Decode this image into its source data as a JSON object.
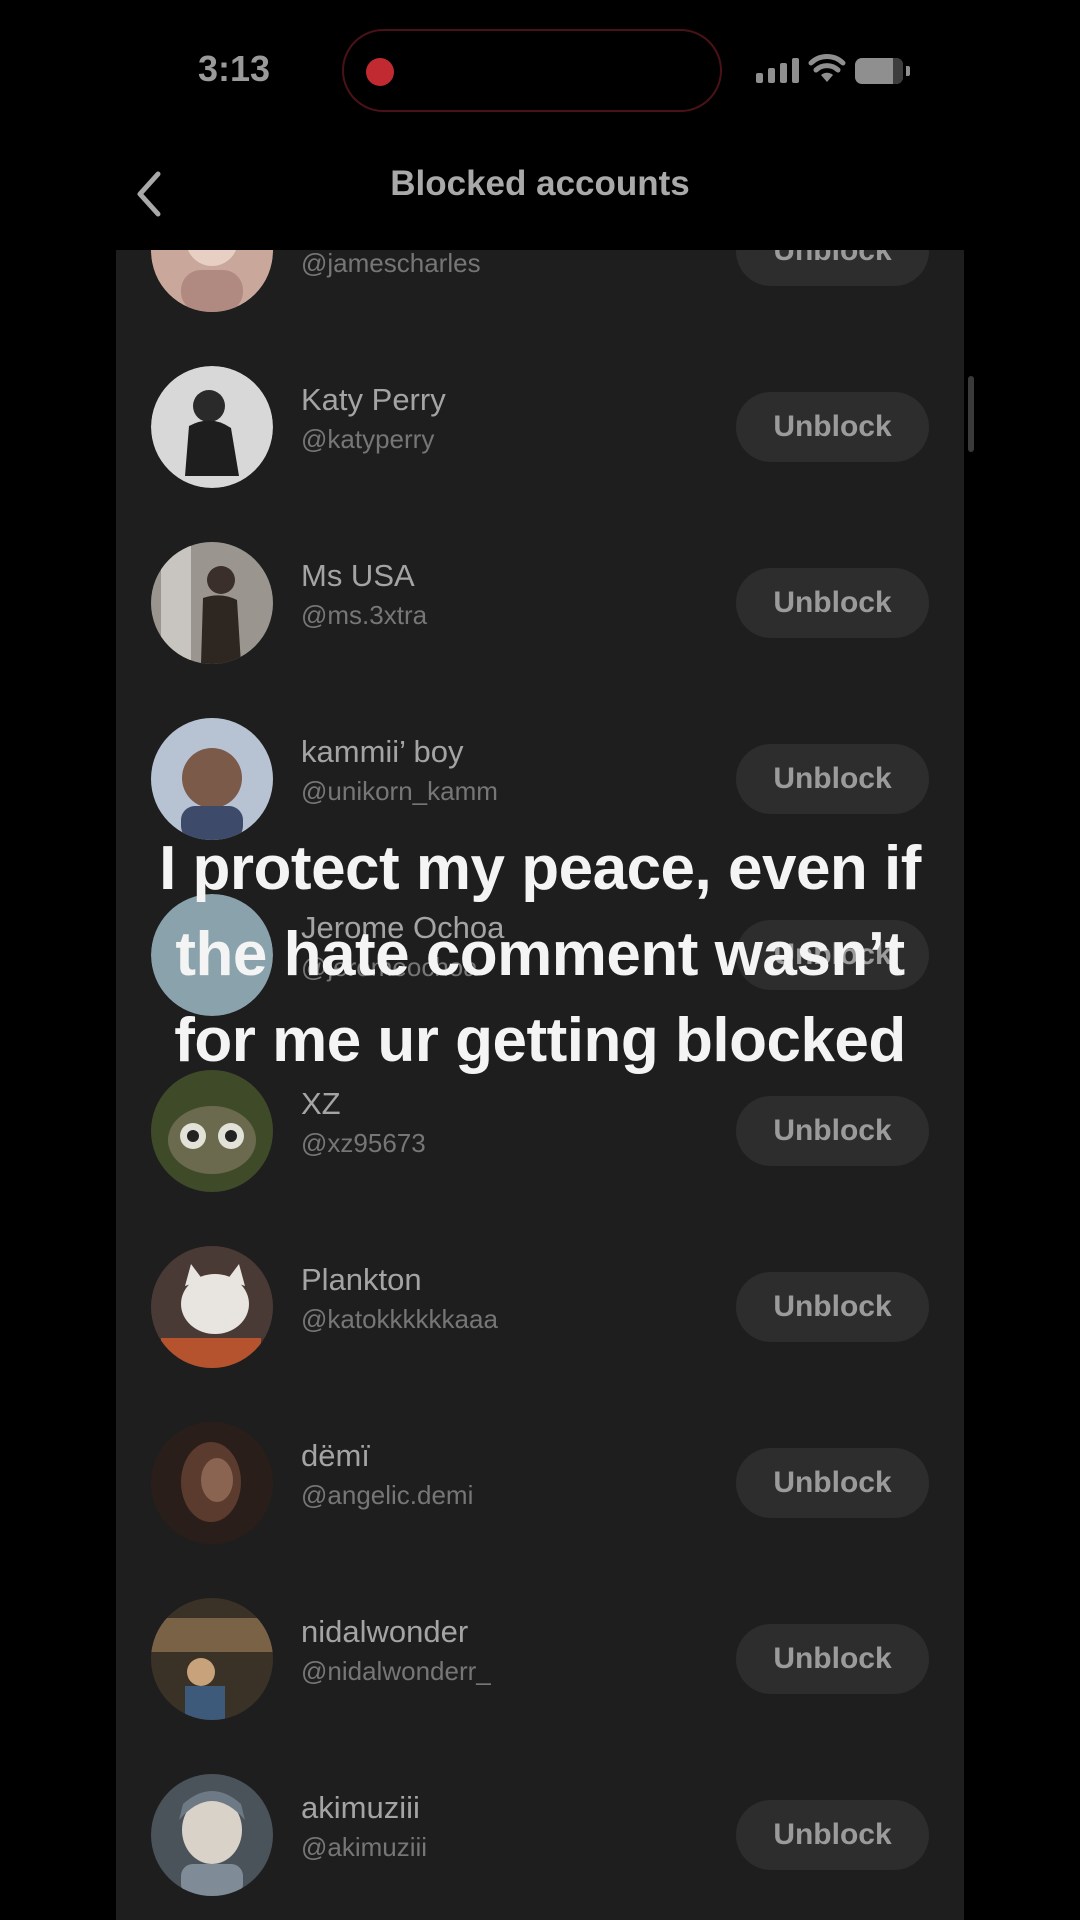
{
  "status_bar": {
    "time": "3:13",
    "recording_color": "#c02a30"
  },
  "header": {
    "title": "Blocked accounts",
    "back_icon": "chevron-left-icon"
  },
  "unblock_label": "Unblock",
  "accounts": [
    {
      "name": "",
      "handle": "@jamescharles",
      "avatar_color": "#c9a79b"
    },
    {
      "name": "Katy Perry",
      "handle": "@katyperry",
      "avatar_color": "#d8d8d8"
    },
    {
      "name": "Ms USA",
      "handle": "@ms.3xtra",
      "avatar_color": "#8a8680"
    },
    {
      "name": "kammii’ boy",
      "handle": "@unikorn_kamm",
      "avatar_color": "#7b5a4a"
    },
    {
      "name": "Jerome Ochoa",
      "handle": "@jeromeochoa",
      "avatar_color": "#8aa2ac"
    },
    {
      "name": "XZ",
      "handle": "@xz95673",
      "avatar_color": "#3f4a28"
    },
    {
      "name": " Plankton",
      "handle": "@katokkkkkkaaa",
      "avatar_color": "#d9d4cf"
    },
    {
      "name": "dëmï",
      "handle": "@angelic.demi",
      "avatar_color": "#3b2a22"
    },
    {
      "name": "nidalwonder",
      "handle": "@nidalwonderr_",
      "avatar_color": "#5a4a34"
    },
    {
      "name": "akimuziii",
      "handle": "@akimuziii",
      "avatar_color": "#6d7a86"
    }
  ],
  "caption": {
    "line1": "I protect my peace, even if",
    "line2": "the hate comment wasn’t",
    "line3": "for me ur getting blocked"
  }
}
